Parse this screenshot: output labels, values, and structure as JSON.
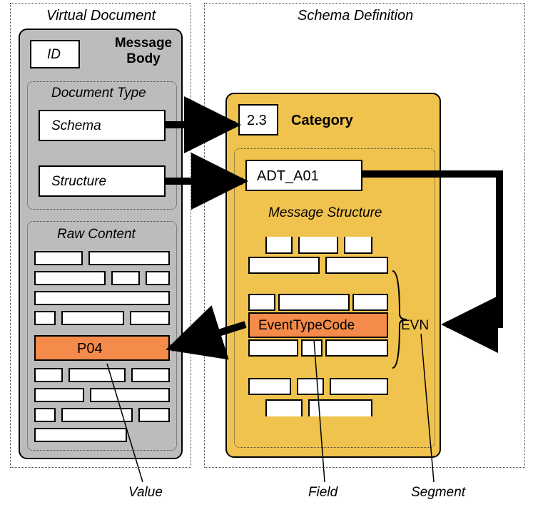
{
  "regions": {
    "virtual_document": {
      "title": "Virtual Document"
    },
    "schema_definition": {
      "title": "Schema Definition"
    }
  },
  "message_body": {
    "title": "Message Body",
    "id_label": "ID",
    "document_type": {
      "title": "Document Type",
      "schema": "Schema",
      "structure": "Structure"
    },
    "raw_content": {
      "title": "Raw Content",
      "highlighted_value": "P04"
    }
  },
  "schema_def": {
    "category_value": "2.3",
    "category_label": "Category",
    "message_structure": {
      "title": "Message Structure",
      "adt_value": "ADT_A01",
      "field_label": "EventTypeCode",
      "segment_label": "EVN"
    }
  },
  "legend": {
    "value": "Value",
    "field": "Field",
    "segment": "Segment"
  },
  "chart_data": {
    "type": "table",
    "description": "Architecture diagram: a Virtual Document message body contains Document Type (Schema + Structure) and Raw Content; these map to a Schema Definition with Category 2.3, Message Structure ADT_A01, Segment EVN, Field EventTypeCode, yielding Value P04.",
    "nodes": [
      {
        "id": "id",
        "group": "Virtual Document / Message Body",
        "label": "ID"
      },
      {
        "id": "schema",
        "group": "Virtual Document / Document Type",
        "label": "Schema"
      },
      {
        "id": "structure",
        "group": "Virtual Document / Document Type",
        "label": "Structure"
      },
      {
        "id": "raw_value_P04",
        "group": "Virtual Document / Raw Content",
        "label": "P04",
        "role": "Value"
      },
      {
        "id": "category_2_3",
        "group": "Schema Definition",
        "label": "2.3",
        "role": "Category"
      },
      {
        "id": "adt_a01",
        "group": "Schema Definition / Message Structure",
        "label": "ADT_A01"
      },
      {
        "id": "segment_EVN",
        "group": "Schema Definition / Message Structure",
        "label": "EVN",
        "role": "Segment"
      },
      {
        "id": "field_EventTypeCode",
        "group": "Schema Definition / Message Structure",
        "label": "EventTypeCode",
        "role": "Field"
      }
    ],
    "edges": [
      {
        "from": "schema",
        "to": "category_2_3"
      },
      {
        "from": "structure",
        "to": "adt_a01"
      },
      {
        "from": "adt_a01",
        "to": "segment_EVN"
      },
      {
        "from": "segment_EVN",
        "to": "field_EventTypeCode"
      },
      {
        "from": "field_EventTypeCode",
        "to": "raw_value_P04"
      }
    ]
  }
}
